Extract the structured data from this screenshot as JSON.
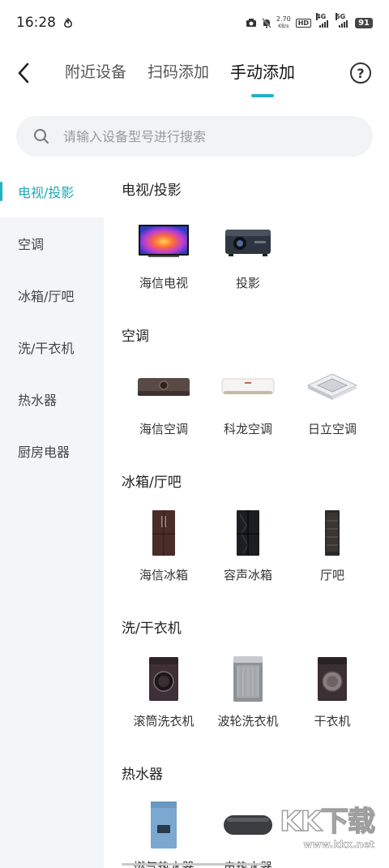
{
  "status_bar": {
    "time": "16:28",
    "net_speed_value": "2.70",
    "net_speed_unit": "KB/s",
    "hd_badge": "HD",
    "signal1": "4G",
    "signal2": "5G",
    "battery": "91"
  },
  "header": {
    "tabs": [
      {
        "label": "附近设备",
        "active": false
      },
      {
        "label": "扫码添加",
        "active": false
      },
      {
        "label": "手动添加",
        "active": true
      }
    ],
    "help": "?"
  },
  "search": {
    "placeholder": "请输入设备型号进行搜索",
    "value": ""
  },
  "sidebar": {
    "items": [
      {
        "label": "电视/投影",
        "active": true
      },
      {
        "label": "空调",
        "active": false
      },
      {
        "label": "冰箱/厅吧",
        "active": false
      },
      {
        "label": "洗/干衣机",
        "active": false
      },
      {
        "label": "热水器",
        "active": false
      },
      {
        "label": "厨房电器",
        "active": false
      }
    ]
  },
  "sections": [
    {
      "title": "电视/投影",
      "items": [
        {
          "label": "海信电视",
          "icon": "tv-icon"
        },
        {
          "label": "投影",
          "icon": "projector-icon"
        }
      ]
    },
    {
      "title": "空调",
      "items": [
        {
          "label": "海信空调",
          "icon": "ac-unit-icon"
        },
        {
          "label": "科龙空调",
          "icon": "ac-unit-white-icon"
        },
        {
          "label": "日立空调",
          "icon": "ceiling-ac-icon"
        }
      ]
    },
    {
      "title": "冰箱/厅吧",
      "items": [
        {
          "label": "海信冰箱",
          "icon": "fridge-icon"
        },
        {
          "label": "容声冰箱",
          "icon": "fridge-black-icon"
        },
        {
          "label": "厅吧",
          "icon": "wine-cabinet-icon"
        }
      ]
    },
    {
      "title": "洗/干衣机",
      "items": [
        {
          "label": "滚筒洗衣机",
          "icon": "front-washer-icon"
        },
        {
          "label": "波轮洗衣机",
          "icon": "top-washer-icon"
        },
        {
          "label": "干衣机",
          "icon": "dryer-icon"
        }
      ]
    },
    {
      "title": "热水器",
      "items": [
        {
          "label": "燃气热水器",
          "icon": "gas-heater-icon"
        },
        {
          "label": "电热水器",
          "icon": "electric-heater-icon"
        }
      ]
    }
  ],
  "watermark": {
    "logo": "KK下载",
    "url": "www.kkx.net"
  },
  "colors": {
    "accent": "#1fb4c0",
    "sidebar_bg": "#f4f5f7",
    "search_bg": "#f2f3f5"
  }
}
